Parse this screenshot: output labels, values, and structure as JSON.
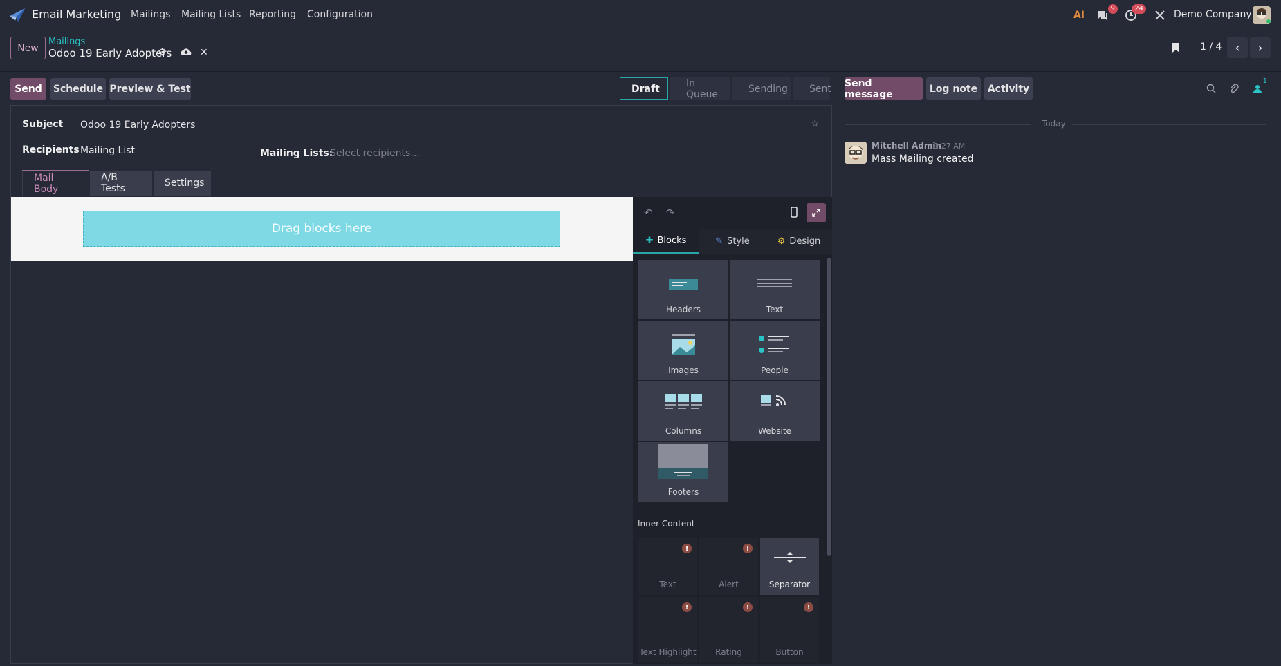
{
  "navbar": {
    "app_name": "Email Marketing",
    "menu": [
      "Mailings",
      "Mailing Lists",
      "Reporting",
      "Configuration"
    ],
    "messages_badge": "9",
    "activities_badge": "24",
    "company": "Demo Company"
  },
  "control_panel": {
    "new_label": "New",
    "breadcrumb_parent": "Mailings",
    "record_name": "Odoo 19 Early Adopters",
    "pager": "1 / 4"
  },
  "actions": {
    "send": "Send",
    "schedule": "Schedule",
    "preview": "Preview & Test"
  },
  "stages": [
    "Draft",
    "In Queue",
    "Sending",
    "Sent"
  ],
  "active_stage": "Draft",
  "form": {
    "subject_label": "Subject",
    "subject_value": "Odoo 19 Early Adopters",
    "recipients_label": "Recipients",
    "recipients_value": "Mailing List",
    "mailing_lists_label": "Mailing Lists:",
    "mailing_lists_placeholder": "Select recipients...",
    "tabs": [
      "Mail Body",
      "A/B Tests",
      "Settings"
    ]
  },
  "editor": {
    "dropzone": "Drag blocks here",
    "panel_tabs": [
      "Blocks",
      "Style",
      "Design"
    ],
    "blocks": [
      "Headers",
      "Text",
      "Images",
      "People",
      "Columns",
      "Website",
      "Footers"
    ],
    "inner_content_title": "Inner Content",
    "inner_blocks": [
      "Text",
      "Alert",
      "Separator",
      "Text Highlight",
      "Rating",
      "Button"
    ]
  },
  "chatter": {
    "send_message": "Send message",
    "log_note": "Log note",
    "activity": "Activity",
    "followers_count": "1",
    "today": "Today",
    "message": {
      "author": "Mitchell Admin",
      "time": "9:27 AM",
      "body": "Mass Mailing created"
    }
  },
  "colors": {
    "primary": "#714b67",
    "accent_teal": "#29a6a7",
    "background": "#262a36",
    "dropzone": "#7ed9e5"
  }
}
